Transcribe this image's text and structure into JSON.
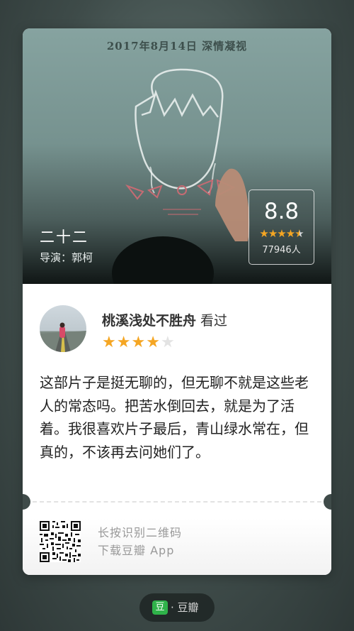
{
  "poster": {
    "caption": "2017年8月14日 深情凝视"
  },
  "movie": {
    "title": "二十二",
    "director_label": "导演：郭柯"
  },
  "rating": {
    "score": "8.8",
    "stars": 4.5,
    "count": "77946人"
  },
  "user": {
    "name": "桃溪浅处不胜舟",
    "action": "看过",
    "stars": 4
  },
  "review": {
    "text": "这部片子是挺无聊的，但无聊不就是这些老人的常态吗。把苦水倒回去，就是为了活着。我很喜欢片子最后，青山绿水常在，但真的，不该再去问她们了。"
  },
  "footer": {
    "line1": "长按识别二维码",
    "line2": "下载豆瓣 App"
  },
  "brand": {
    "logo_char": "豆",
    "text": "· 豆瓣"
  },
  "colors": {
    "star": "#f5a623",
    "brand_green": "#2fb34a"
  }
}
